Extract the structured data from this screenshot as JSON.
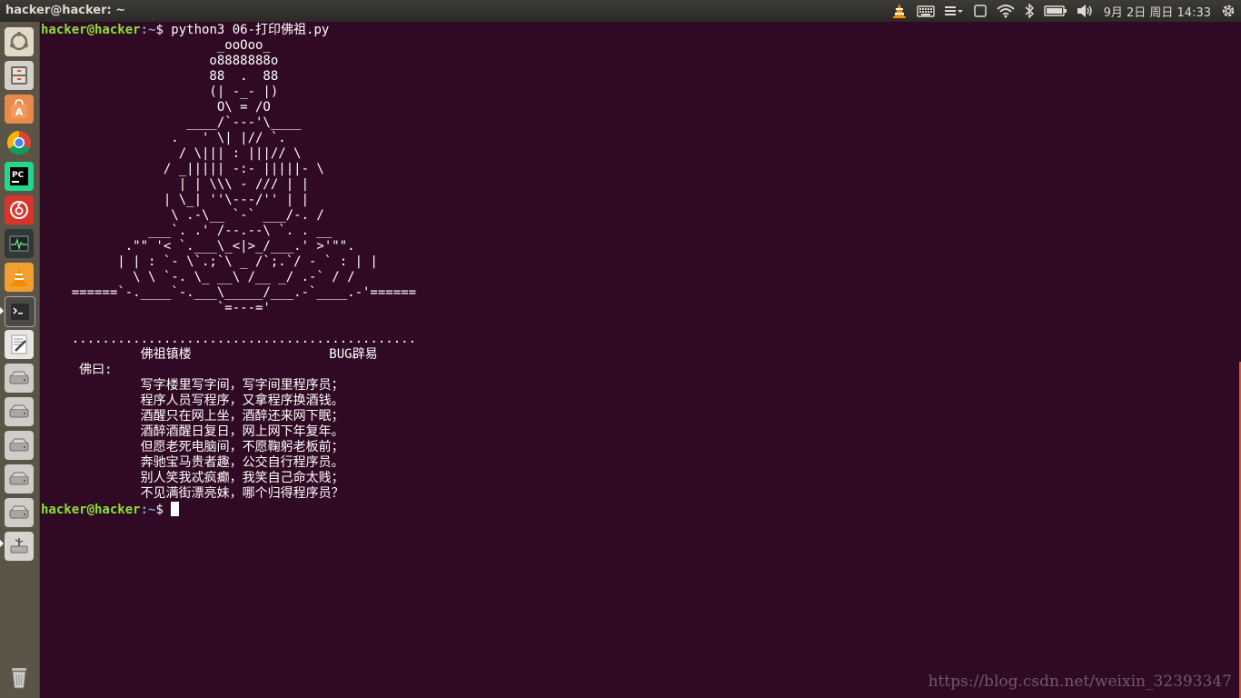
{
  "panel": {
    "window_title": "hacker@hacker: ~",
    "datetime": "9月 2日 周日 14:33"
  },
  "launcher": {
    "items": [
      {
        "name": "dash-home",
        "icon": "ubuntu-logo-icon"
      },
      {
        "name": "files",
        "icon": "file-cabinet-icon"
      },
      {
        "name": "software-center",
        "icon": "software-bag-icon"
      },
      {
        "name": "chrome",
        "icon": "chrome-icon"
      },
      {
        "name": "pycharm",
        "icon": "pycharm-icon"
      },
      {
        "name": "netease-music",
        "icon": "music-icon"
      },
      {
        "name": "system-monitor",
        "icon": "monitor-icon"
      },
      {
        "name": "vlc",
        "icon": "vlc-cone-icon"
      },
      {
        "name": "terminal",
        "icon": "terminal-icon"
      },
      {
        "name": "text-editor",
        "icon": "text-editor-icon"
      },
      {
        "name": "drive-1",
        "icon": "drive-icon"
      },
      {
        "name": "drive-2",
        "icon": "drive-icon"
      },
      {
        "name": "drive-3",
        "icon": "drive-icon"
      },
      {
        "name": "drive-4",
        "icon": "drive-icon"
      },
      {
        "name": "drive-5",
        "icon": "drive-icon"
      },
      {
        "name": "usb-drive",
        "icon": "usb-icon"
      },
      {
        "name": "trash",
        "icon": "trash-icon"
      }
    ]
  },
  "terminal": {
    "user_host": "hacker@hacker",
    "path": ":~",
    "command": "$ python3 06-打印佛祖.py",
    "output": "                       _ooOoo_\n                      o8888888o\n                      88  .  88\n                      (| -_- |)\n                       O\\ = /O\n                   ____/`---'\\____\n                 .   ' \\| |// `.\n                  / \\||| : |||// \\\n                / _||||| -:- |||||- \\\n                  | | \\\\\\ - /// | |\n                | \\_| ''\\---/'' | |\n                 \\ .-\\__ `-` ___/-. /\n              ___`. .' /--.--\\ `. . __\n           .\"\" '< `.___\\_<|>_/___.' >'\"\".\n          | | : `- \\`.;`\\ _ /`;.`/ - ` : | |\n            \\ \\ `-. \\_ __\\ /__ _/ .-` / /\n    ======`-.____`-.___\\_____/___.-`____.-'======\n                       `=---='\n\n    .............................................\n             佛祖镇楼                  BUG辟易\n     佛曰:\n             写字楼里写字间，写字间里程序员；\n             程序人员写程序，又拿程序换酒钱。\n             酒醒只在网上坐，酒醉还来网下眠；\n             酒醉酒醒日复日，网上网下年复年。\n             但愿老死电脑间，不愿鞠躬老板前；\n             奔驰宝马贵者趣，公交自行程序员。\n             别人笑我忒疯癫，我笑自己命太贱；\n             不见满街漂亮妹，哪个归得程序员？",
    "prompt_end": "$ "
  },
  "watermark": "https://blog.csdn.net/weixin_32393347",
  "colors": {
    "terminal_bg": "#300a24",
    "prompt_user": "#8ae234",
    "prompt_path": "#729fcf",
    "panel_bg": "#3c3b37",
    "launcher_bg": "#5a5547",
    "accent": "#e95420"
  }
}
